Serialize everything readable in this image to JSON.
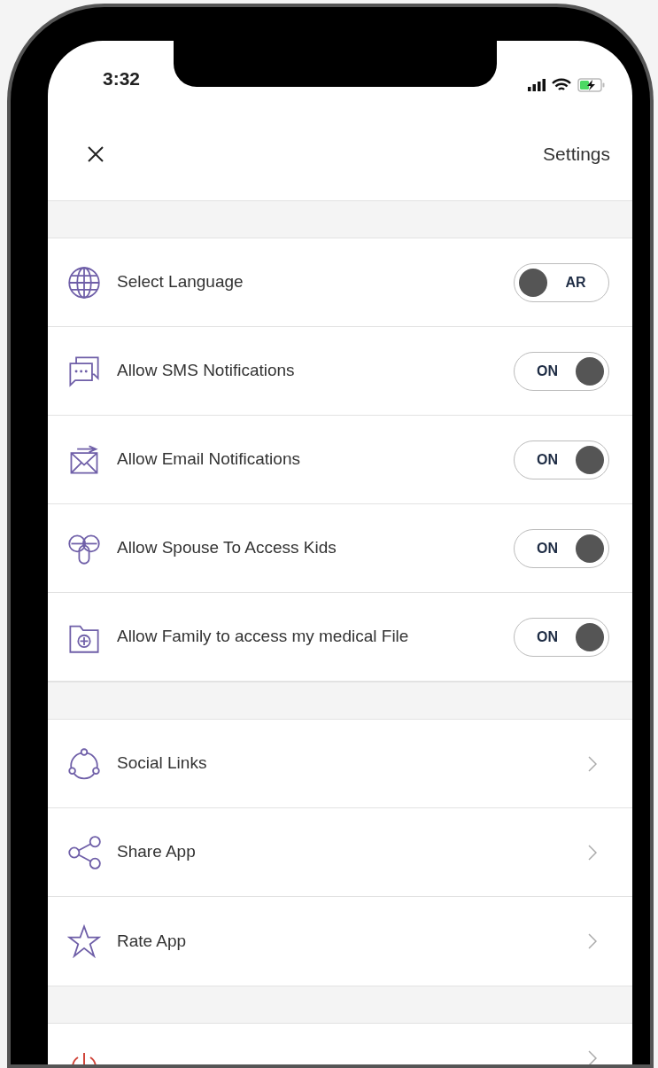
{
  "status_bar": {
    "time": "3:32"
  },
  "header": {
    "title": "Settings"
  },
  "toggle_rows": [
    {
      "label": "Select Language",
      "toggle": {
        "text": "AR",
        "on": false
      }
    },
    {
      "label": "Allow SMS Notifications",
      "toggle": {
        "text": "ON",
        "on": true
      }
    },
    {
      "label": "Allow Email Notifications",
      "toggle": {
        "text": "ON",
        "on": true
      }
    },
    {
      "label": "Allow Spouse To Access Kids",
      "toggle": {
        "text": "ON",
        "on": true
      }
    },
    {
      "label": "Allow Family to access my medical File",
      "toggle": {
        "text": "ON",
        "on": true
      }
    }
  ],
  "link_rows": [
    {
      "label": "Social Links"
    },
    {
      "label": "Share App"
    },
    {
      "label": "Rate App"
    }
  ]
}
